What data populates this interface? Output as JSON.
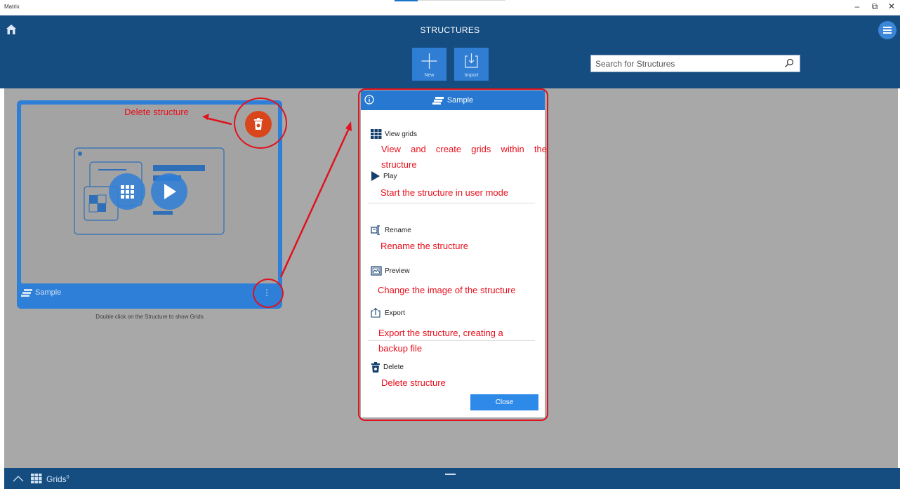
{
  "window": {
    "app_title": "Matrix",
    "controls": {
      "minimize": "–",
      "restore": "⧉",
      "close": "✕"
    }
  },
  "header": {
    "title": "STRUCTURES",
    "buttons": [
      {
        "label": "New",
        "icon": "plus-icon"
      },
      {
        "label": "Import",
        "icon": "import-icon"
      }
    ],
    "search_placeholder": "Search for Structures"
  },
  "card": {
    "name": "Sample",
    "hint": "Double click on the Structure to show Grids"
  },
  "annotations": {
    "delete_fab": "Delete structure"
  },
  "dialog": {
    "title": "Sample",
    "items": [
      {
        "label": "View grids",
        "icon": "grid-icon",
        "note": "View and create grids within the structure"
      },
      {
        "label": "Play",
        "icon": "play-icon",
        "note": "Start the structure in user mode"
      },
      {
        "label": "Rename",
        "icon": "rename-icon",
        "note": "Rename the structure"
      },
      {
        "label": "Preview",
        "icon": "preview-icon",
        "note": "Change the image of the structure"
      },
      {
        "label": "Export",
        "icon": "export-icon",
        "note": "Export the structure, creating a backup file"
      },
      {
        "label": "Delete",
        "icon": "trash-icon",
        "note": "Delete structure"
      }
    ],
    "close_label": "Close"
  },
  "bottombar": {
    "label": "Grids",
    "count": "0"
  },
  "colors": {
    "header": "#154d80",
    "accent": "#2e7fd8",
    "annotation": "#e0121d",
    "delete_fab": "#d9461b"
  }
}
